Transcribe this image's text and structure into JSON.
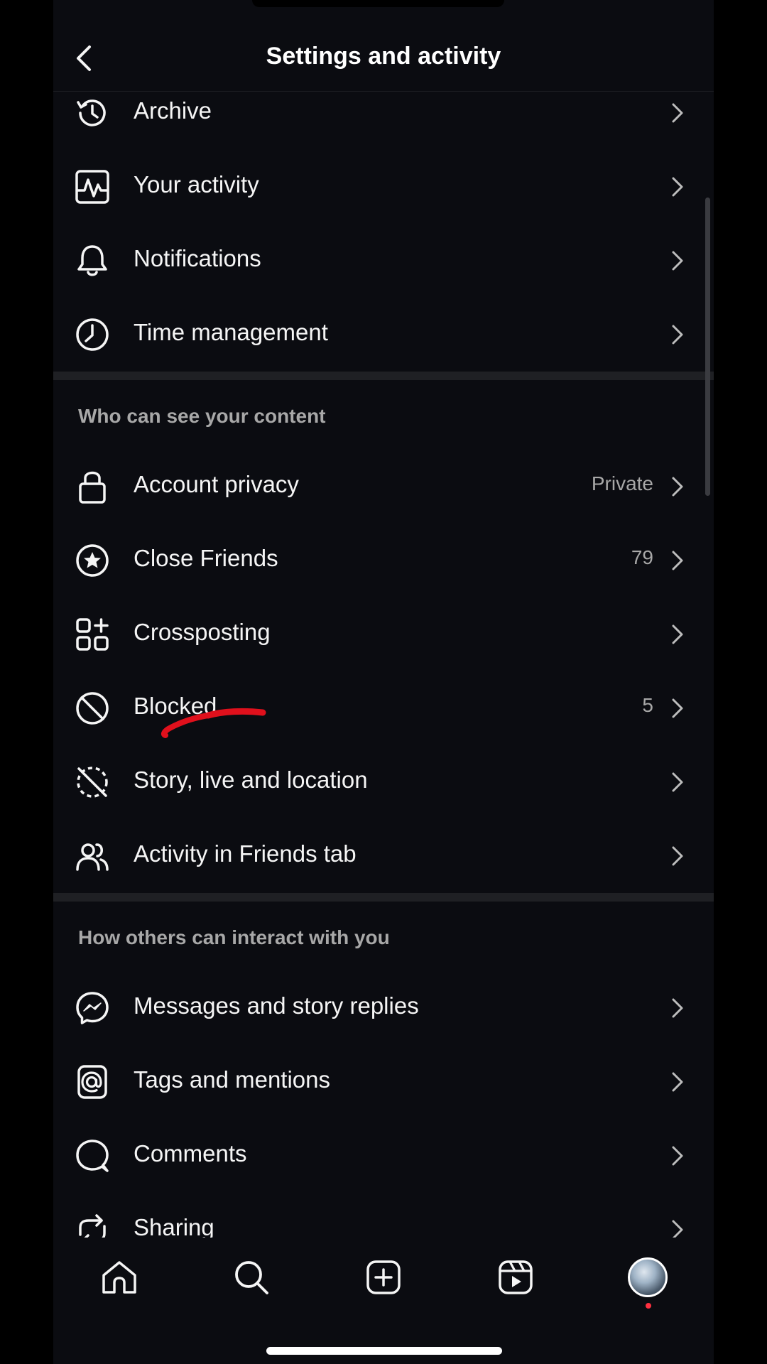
{
  "header": {
    "title": "Settings and activity"
  },
  "rows_top": [
    {
      "label": "Archive",
      "icon": "archive-icon"
    },
    {
      "label": "Your activity",
      "icon": "activity-icon"
    },
    {
      "label": "Notifications",
      "icon": "bell-icon"
    },
    {
      "label": "Time management",
      "icon": "clock-icon"
    }
  ],
  "section_content": {
    "title": "Who can see your content",
    "rows": [
      {
        "label": "Account privacy",
        "value": "Private",
        "icon": "lock-icon"
      },
      {
        "label": "Close Friends",
        "value": "79",
        "icon": "star-circle-icon"
      },
      {
        "label": "Crossposting",
        "value": "",
        "icon": "crosspost-icon"
      },
      {
        "label": "Blocked",
        "value": "5",
        "icon": "blocked-icon"
      },
      {
        "label": "Story, live and location",
        "value": "",
        "icon": "story-off-icon"
      },
      {
        "label": "Activity in Friends tab",
        "value": "",
        "icon": "friends-icon"
      }
    ]
  },
  "section_interact": {
    "title": "How others can interact with you",
    "rows": [
      {
        "label": "Messages and story replies",
        "icon": "messenger-icon"
      },
      {
        "label": "Tags and mentions",
        "icon": "at-icon"
      },
      {
        "label": "Comments",
        "icon": "comment-icon"
      },
      {
        "label": "Sharing",
        "icon": "share-icon"
      }
    ]
  },
  "tabbar": {
    "tabs": [
      "home-icon",
      "search-icon",
      "create-icon",
      "reels-icon",
      "profile-avatar"
    ]
  },
  "colors": {
    "background": "#0b0c11",
    "text": "#f5f5f5",
    "secondary_text": "#a8a8a8",
    "annotation": "#e0101c",
    "notification_dot": "#ff3040"
  }
}
